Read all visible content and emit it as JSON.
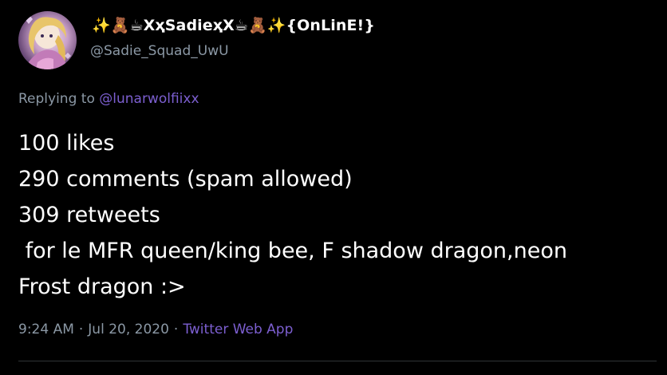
{
  "tweet": {
    "display_name": {
      "prefix_emoji": "✨🧸☕",
      "name": "XҳSadieҳX",
      "suffix_emoji": "☕🧸✨",
      "status": "{OnLinE!}"
    },
    "handle": "@Sadie_Squad_UwU",
    "replying_prefix": "Replying to",
    "replying_to": "@lunarwolfiixx",
    "body_lines": [
      "100 likes",
      "290 comments (spam allowed)",
      "309 retweets",
      " for le MFR queen/king bee, F shadow dragon,neon",
      "Frost dragon :>"
    ],
    "time": "9:24 AM",
    "date": "Jul 20, 2020",
    "separator": "·",
    "source_app": "Twitter Web App"
  },
  "colors": {
    "background": "#000000",
    "text_primary": "#ffffff",
    "text_secondary": "#8b98a5",
    "link": "#7c5fd0",
    "divider": "#2f3336"
  }
}
